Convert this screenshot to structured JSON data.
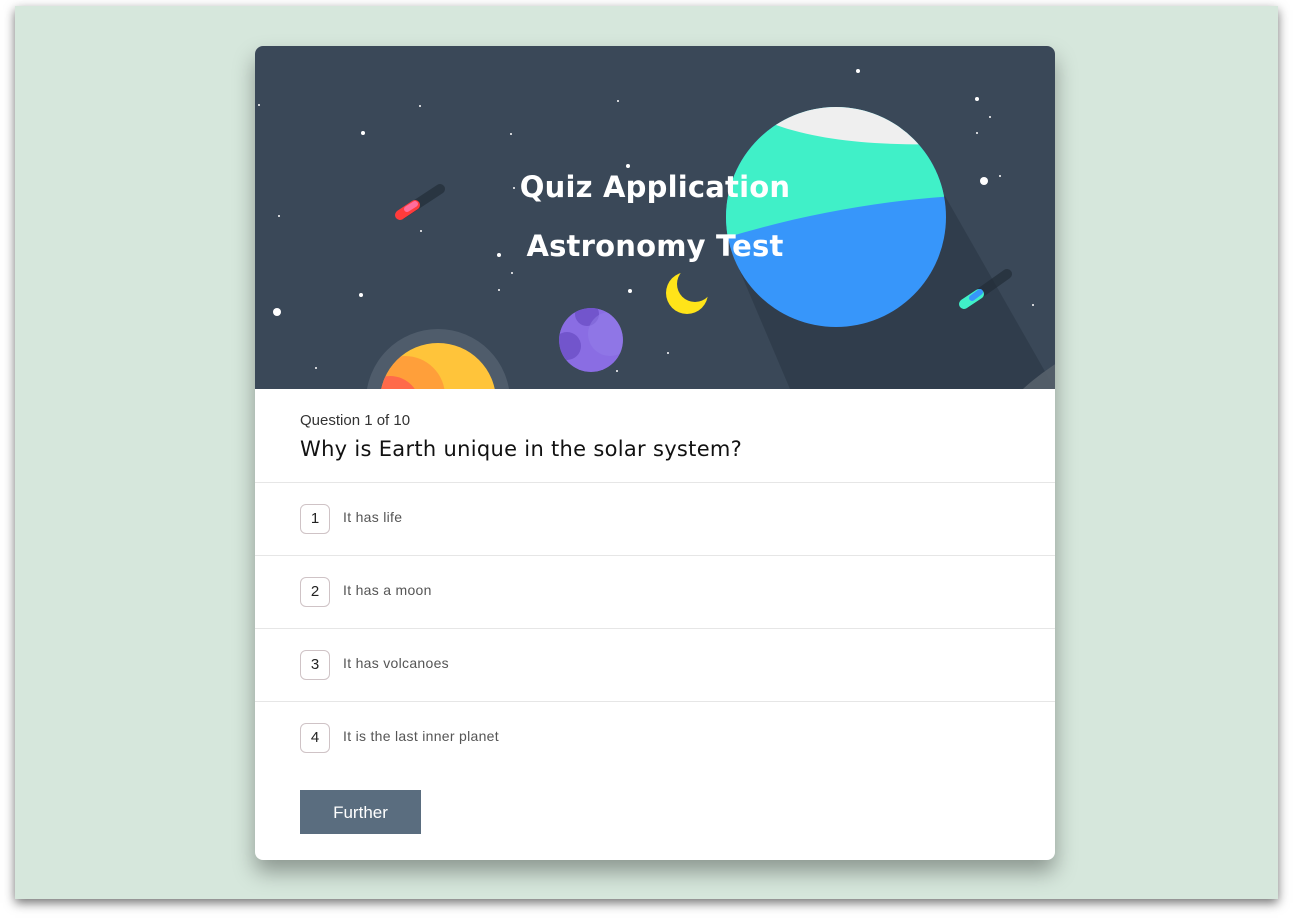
{
  "hero": {
    "title": "Quiz Application",
    "subtitle": "Astronomy Test"
  },
  "question": {
    "counter": "Question 1 of 10",
    "text": "Why is Earth unique in the solar system?"
  },
  "answers": [
    {
      "number": "1",
      "label": "It has life"
    },
    {
      "number": "2",
      "label": "It has a moon"
    },
    {
      "number": "3",
      "label": "It has volcanoes"
    },
    {
      "number": "4",
      "label": "It is the last inner planet"
    }
  ],
  "actions": {
    "further_label": "Further"
  },
  "colors": {
    "page_background": "#d6e7dc",
    "hero_background": "#3a4858",
    "button": "#5a6d7f",
    "planet_teal": "#40f0c8",
    "planet_blue": "#3796fa",
    "planet_purple": "#8a6de3",
    "moon_yellow": "#ffe419"
  }
}
